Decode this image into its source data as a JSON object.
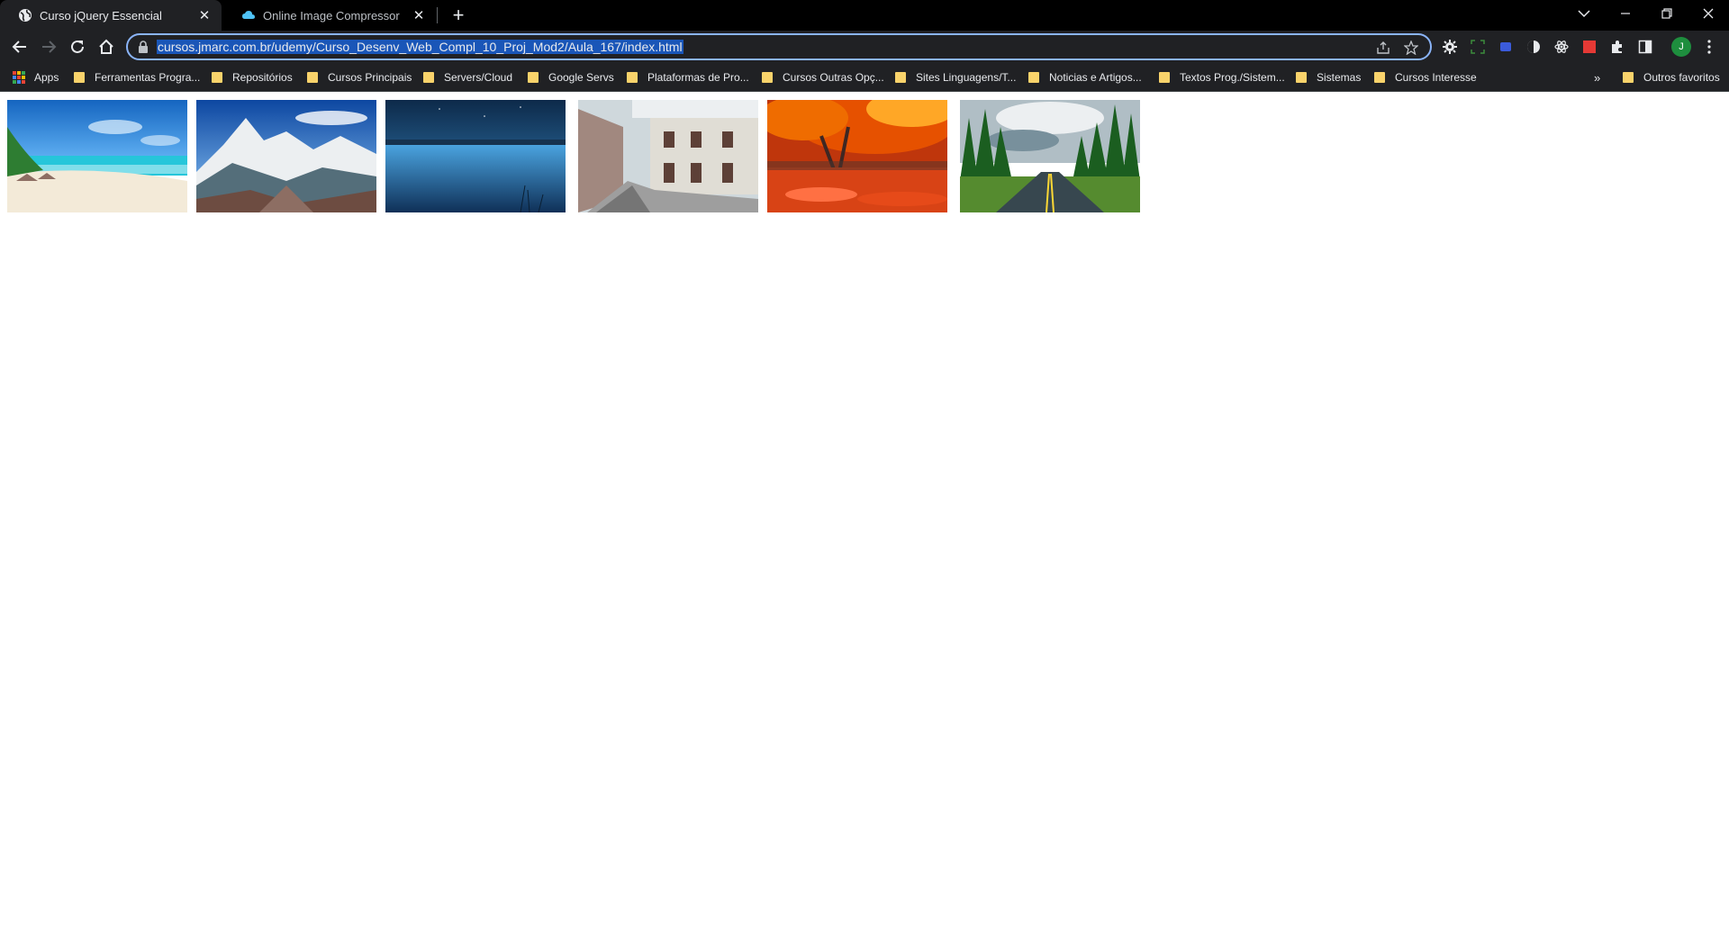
{
  "tabs": [
    {
      "title": "Curso jQuery Essencial",
      "active": true
    },
    {
      "title": "Online Image Compressor",
      "active": false
    }
  ],
  "omnibox": {
    "url": "cursos.jmarc.com.br/udemy/Curso_Desenv_Web_Compl_10_Proj_Mod2/Aula_167/index.html"
  },
  "profile": {
    "initial": "J"
  },
  "bookmarks": {
    "apps": "Apps",
    "items": [
      "Ferramentas Progra...",
      "Repositórios",
      "Cursos Principais",
      "Servers/Cloud",
      "Google Servs",
      "Plataformas de Pro...",
      "Cursos Outras Opç...",
      "Sites Linguagens/T...",
      "Noticias e Artigos...",
      "Textos Prog./Sistem...",
      "Sistemas",
      "Cursos Interesse"
    ],
    "overflow": "»",
    "other": "Outros favoritos"
  },
  "gallery": [
    {
      "name": "beach-photo"
    },
    {
      "name": "mountain-photo"
    },
    {
      "name": "lake-night-photo"
    },
    {
      "name": "street-photo"
    },
    {
      "name": "autumn-leaves-photo"
    },
    {
      "name": "forest-road-photo"
    }
  ],
  "colors": {
    "accent": "#8ab4f8",
    "selection": "#1a56b8",
    "folder": "#f9d36b",
    "chrome_bg": "#202124"
  }
}
